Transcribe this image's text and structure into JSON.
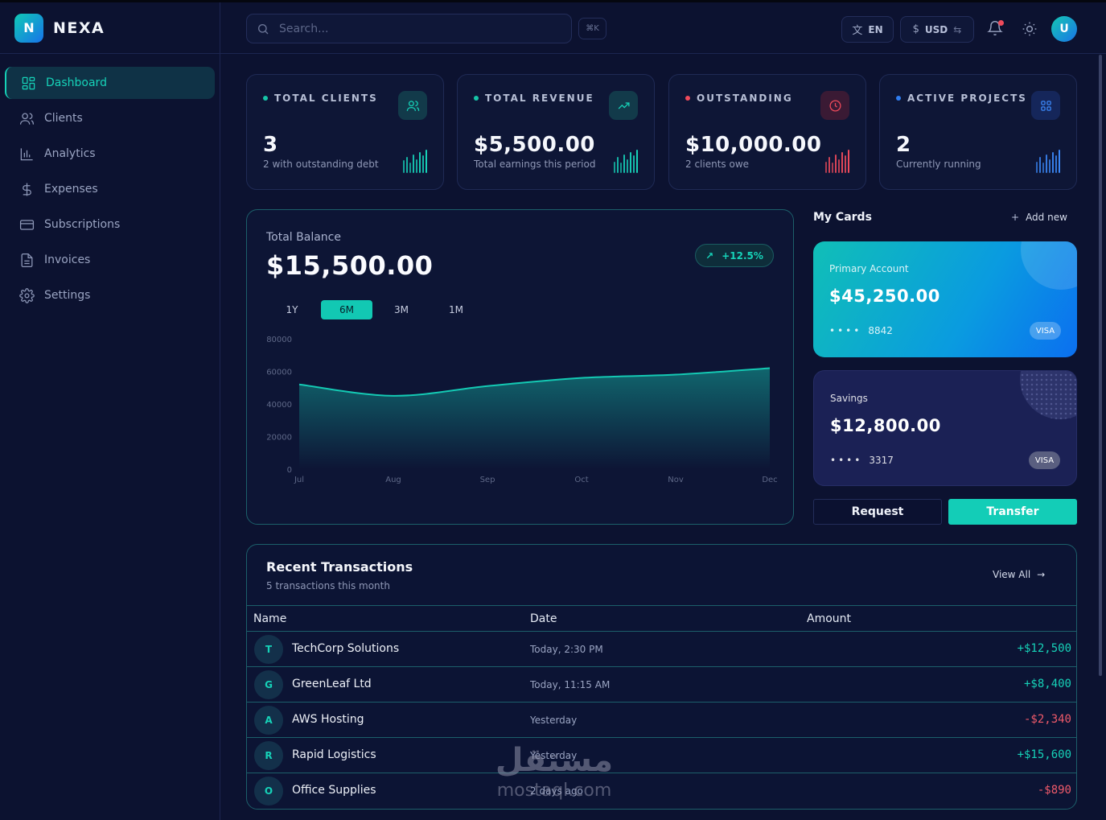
{
  "brand": {
    "logo_letter": "N",
    "name": "NEXA"
  },
  "sidebar": {
    "items": [
      {
        "label": "Dashboard",
        "icon": "grid-icon",
        "active": true
      },
      {
        "label": "Clients",
        "icon": "users-icon"
      },
      {
        "label": "Analytics",
        "icon": "bar-chart-icon"
      },
      {
        "label": "Expenses",
        "icon": "dollar-icon"
      },
      {
        "label": "Subscriptions",
        "icon": "credit-card-icon"
      },
      {
        "label": "Invoices",
        "icon": "file-icon"
      },
      {
        "label": "Settings",
        "icon": "gear-icon"
      }
    ]
  },
  "header": {
    "search_placeholder": "Search...",
    "shortcut": "⌘K",
    "language": "EN",
    "currency_symbol": "$",
    "currency": "USD",
    "avatar_initial": "U"
  },
  "stats": [
    {
      "title": "TOTAL CLIENTS",
      "value": "3",
      "sub": "2 with outstanding debt",
      "dot_color": "#16c4a8",
      "icon": "users-icon",
      "accent": "#16d2b8",
      "bar_heights": [
        0.55,
        0.7,
        0.45,
        0.8,
        0.6,
        0.9,
        0.75,
        1.0
      ]
    },
    {
      "title": "TOTAL REVENUE",
      "value": "$5,500.00",
      "sub": "Total earnings this period",
      "dot_color": "#16c4a8",
      "icon": "trending-up-icon",
      "accent": "#16d2b8",
      "bar_heights": [
        0.5,
        0.7,
        0.45,
        0.8,
        0.6,
        0.9,
        0.75,
        1.0
      ]
    },
    {
      "title": "OUTSTANDING",
      "value": "$10,000.00",
      "sub": "2 clients owe",
      "dot_color": "#ef4a5b",
      "icon": "clock-icon",
      "accent": "#ef4a5b",
      "bar_heights": [
        0.5,
        0.7,
        0.45,
        0.8,
        0.6,
        0.9,
        0.75,
        1.0
      ]
    },
    {
      "title": "ACTIVE PROJECTS",
      "value": "2",
      "sub": "Currently running",
      "dot_color": "#2f7df0",
      "icon": "grid-icon",
      "accent": "#3a86f5",
      "bar_heights": [
        0.5,
        0.7,
        0.45,
        0.8,
        0.6,
        0.9,
        0.75,
        1.0
      ]
    }
  ],
  "balance": {
    "label": "Total Balance",
    "value": "$15,500.00",
    "change": "+12.5%",
    "ranges": [
      {
        "label": "1Y",
        "active": false
      },
      {
        "label": "6M",
        "active": true
      },
      {
        "label": "3M",
        "active": false
      },
      {
        "label": "1M",
        "active": false
      }
    ]
  },
  "chart_data": {
    "type": "area",
    "x": [
      "Jul",
      "Aug",
      "Sep",
      "Oct",
      "Nov",
      "Dec"
    ],
    "values": [
      52000,
      45000,
      51000,
      56000,
      58000,
      62000
    ],
    "y_ticks": [
      "80000",
      "60000",
      "40000",
      "20000",
      "0"
    ],
    "ylim": [
      0,
      80000
    ],
    "color": "#14c9b3",
    "grid": false
  },
  "cards": {
    "title": "My Cards",
    "add_label": "Add new",
    "items": [
      {
        "name": "Primary Account",
        "balance": "$45,250.00",
        "mask": "••••",
        "last4": "8842",
        "brand": "VISA"
      },
      {
        "name": "Savings",
        "balance": "$12,800.00",
        "mask": "••••",
        "last4": "3317",
        "brand": "VISA"
      }
    ],
    "request_label": "Request",
    "transfer_label": "Transfer"
  },
  "transactions": {
    "title": "Recent Transactions",
    "subtitle": "5 transactions this month",
    "view_all": "View All",
    "columns": [
      "Name",
      "Date",
      "Amount"
    ],
    "rows": [
      {
        "initial": "T",
        "name": "TechCorp Solutions",
        "date": "Today, 2:30 PM",
        "amount": "+$12,500",
        "positive": true
      },
      {
        "initial": "G",
        "name": "GreenLeaf Ltd",
        "date": "Today, 11:15 AM",
        "amount": "+$8,400",
        "positive": true
      },
      {
        "initial": "A",
        "name": "AWS Hosting",
        "date": "Yesterday",
        "amount": "-$2,340",
        "positive": false
      },
      {
        "initial": "R",
        "name": "Rapid Logistics",
        "date": "Yesterday",
        "amount": "+$15,600",
        "positive": true
      },
      {
        "initial": "O",
        "name": "Office Supplies",
        "date": "2 days ago",
        "amount": "-$890",
        "positive": false
      }
    ]
  },
  "watermark": {
    "arabic": "مستقل",
    "latin": "mostaql.com"
  }
}
